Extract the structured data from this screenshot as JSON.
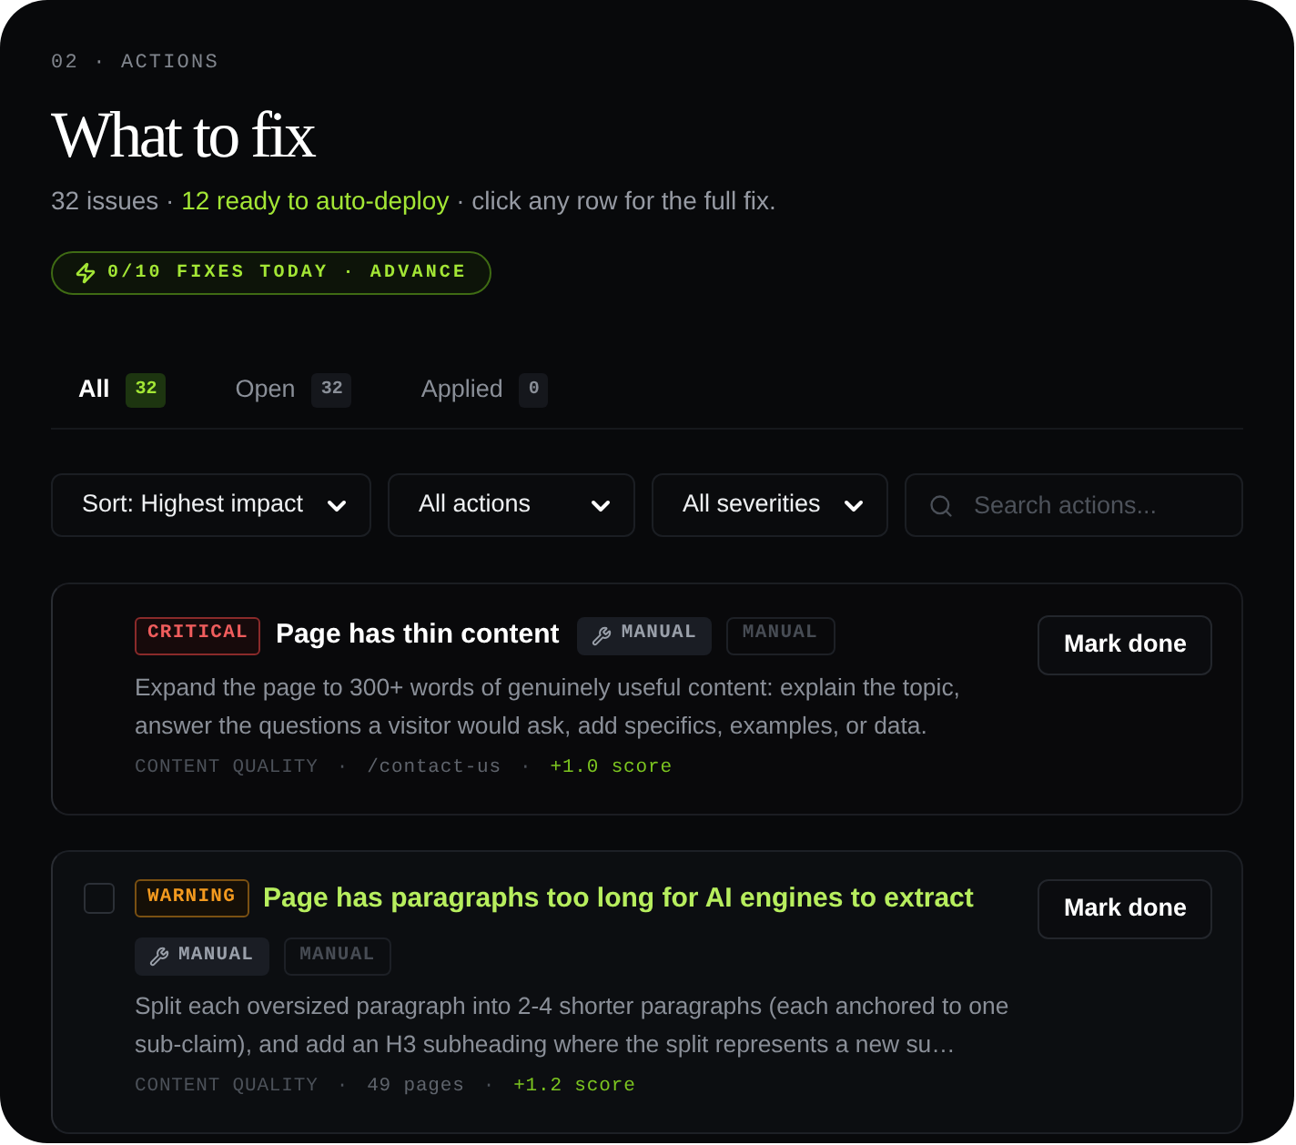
{
  "header": {
    "eyebrow": "02 · ACTIONS",
    "title": "What to fix",
    "summary": [
      {
        "kind": "plain",
        "text": "32 issues · "
      },
      {
        "kind": "highlight",
        "text": "12 ready to auto-deploy"
      },
      {
        "kind": "plain",
        "text": " · click any row for the full fix."
      }
    ],
    "quota_badge": "0/10 FIXES TODAY · ADVANCE"
  },
  "tabs": [
    {
      "label": "All",
      "count": "32",
      "selected": true
    },
    {
      "label": "Open",
      "count": "32",
      "selected": false
    },
    {
      "label": "Applied",
      "count": "0",
      "selected": false
    }
  ],
  "filters": [
    {
      "kind": "select",
      "value": "Sort: Highest impact"
    },
    {
      "kind": "select",
      "value": "All actions"
    },
    {
      "kind": "select",
      "value": "All severities"
    },
    {
      "kind": "search",
      "placeholder": "Search actions..."
    }
  ],
  "cards": [
    {
      "kind": "critical",
      "severity_label": "CRITICAL",
      "title": "Page has thin content",
      "hovered": false,
      "tags": [
        {
          "kind": "tool",
          "label": "MANUAL"
        },
        {
          "kind": "plain",
          "label": "MANUAL"
        }
      ],
      "description": "Expand the page to 300+ words of genuinely useful content: explain the topic, answer the questions a visitor would ask, add specifics, examples, or data.",
      "meta": [
        {
          "kind": "category",
          "text": "CONTENT QUALITY"
        },
        {
          "kind": "separator",
          "text": "·"
        },
        {
          "kind": "path",
          "text": "/contact-us"
        },
        {
          "kind": "separator",
          "text": "·"
        },
        {
          "kind": "score",
          "text": "+1.0 score"
        }
      ],
      "button": "Mark done"
    },
    {
      "kind": "warning",
      "severity_label": "WARNING",
      "title": "Page has paragraphs too long for AI engines to extract",
      "hovered": true,
      "tags": [
        {
          "kind": "tool",
          "label": "MANUAL"
        },
        {
          "kind": "plain",
          "label": "MANUAL"
        }
      ],
      "description": "Split each oversized paragraph into 2-4 shorter paragraphs (each anchored to one sub-claim), and add an H3 subheading where the split represents a new su…",
      "meta": [
        {
          "kind": "category",
          "text": "CONTENT QUALITY"
        },
        {
          "kind": "separator",
          "text": "·"
        },
        {
          "kind": "path",
          "text": "49 pages"
        },
        {
          "kind": "separator",
          "text": "·"
        },
        {
          "kind": "score",
          "text": "+1.2 score"
        }
      ],
      "button": "Mark done"
    }
  ]
}
